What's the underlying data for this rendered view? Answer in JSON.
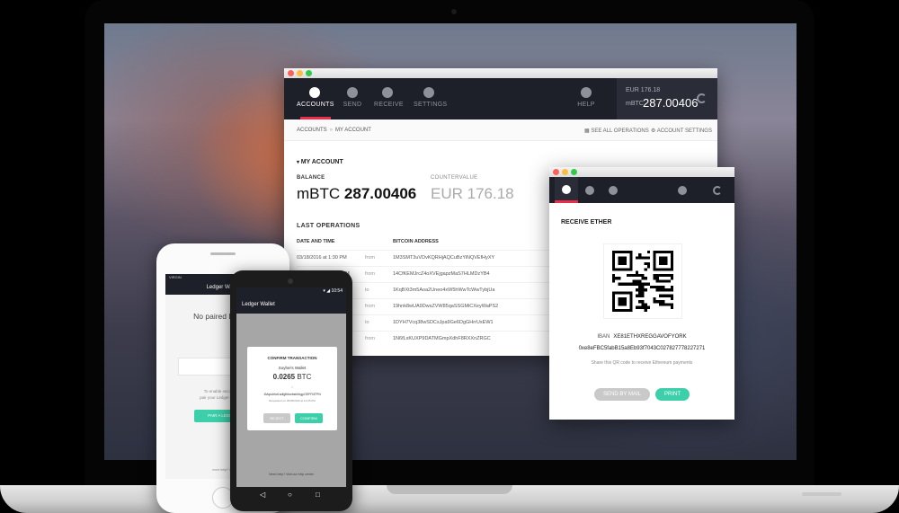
{
  "main_window": {
    "nav": [
      {
        "label": "ACCOUNTS",
        "icon": "accounts-icon",
        "active": true
      },
      {
        "label": "SEND",
        "icon": "send-icon"
      },
      {
        "label": "RECEIVE",
        "icon": "receive-icon"
      },
      {
        "label": "SETTINGS",
        "icon": "settings-icon"
      },
      {
        "label": "HELP",
        "icon": "help-icon"
      }
    ],
    "header_balance": {
      "eur": "EUR 176.18",
      "mbtc_label": "mBTC",
      "mbtc_value": "287.00406"
    },
    "breadcrumb": {
      "root": "ACCOUNTS",
      "sep": "»",
      "current": "MY ACCOUNT"
    },
    "links": {
      "see_all": "SEE ALL OPERATIONS",
      "settings": "ACCOUNT SETTINGS"
    },
    "account_title": "MY ACCOUNT",
    "balance_label": "BALANCE",
    "balance_unit": "mBTC",
    "balance_value": "287.00406",
    "countervalue_label": "COUNTERVALUE",
    "countervalue": "EUR 176.18",
    "last_ops_title": "LAST OPERATIONS",
    "table_headers": {
      "date": "DATE AND TIME",
      "address": "BITCOIN ADDRESS"
    },
    "operations": [
      {
        "date": "03/18/2016 at 1:30 PM",
        "dir": "from",
        "address": "1M3SMT3uVDvKQRHjAQCuBzYiNQVEfHyXY"
      },
      {
        "date": "03/18/2016 at 12:19 PM",
        "dir": "from",
        "address": "14CfKEMJrcZ4oXVEjgapzMaS7HLMDzYB4"
      },
      {
        "date": "M",
        "dir": "to",
        "address": "1KqBXt3m5Aoa2Uneo4xW5hWwTcWwTybjUa"
      },
      {
        "date": "AM",
        "dir": "from",
        "address": "19hnk8wUA9DwsZVW85qaSSGMiCXeyWaPS2"
      },
      {
        "date": "AM",
        "dir": "to",
        "address": "1DYH7Vcq38wSDCsJpa9Ge6DgGHrrUxEW1"
      },
      {
        "date": "M",
        "dir": "from",
        "address": "1N6fLxKUXP9DATMGmpXdhF8RXXnZRGC"
      }
    ]
  },
  "ether_window": {
    "title": "RECEIVE ETHER",
    "iban_label": "IBAN",
    "iban_value": "XE81ETHXREGGAVOFYORK",
    "address": "0xe8eFBC5fabB15a8Eb93f7043C027827778227271",
    "share_text": "Share this QR code to receive Ethereum payments",
    "send_mail": "SEND BY MAIL",
    "print": "PRINT"
  },
  "iphone": {
    "carrier": "VIRGIN",
    "title": "Ledger Wallet",
    "no_paired": "No paired Ledger",
    "hint_line1": "To enable second fac",
    "hint_line2": "pair your Ledger Wallet wi",
    "pair_button": "PAIR A LEDGER",
    "footer": "more help? Vis"
  },
  "android": {
    "time": "10:54",
    "title": "Ledger Wallet",
    "dialog_title": "CONFIRM TRANSACTION",
    "wallet_name": "Soyhei's Wallet",
    "amount": "0.0265",
    "unit": "BTC",
    "address": "1Mqsdrhdt.sdfgfhbwbsirbhgpGEFR4TPN",
    "requested": "Requested on 05/05/2016 at 12:25 PM",
    "reject": "REJECT",
    "confirm": "CONFIRM",
    "footer": "Need help? Visit our help center",
    "nav_back": "◁",
    "nav_home": "○",
    "nav_recent": "□"
  },
  "colors": {
    "accent_red": "#ea2e49",
    "teal": "#3dcfa9",
    "dark": "#1e2029"
  }
}
